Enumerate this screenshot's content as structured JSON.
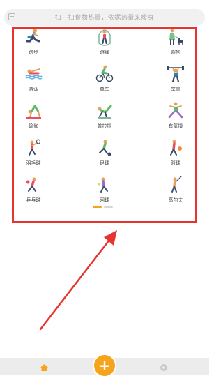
{
  "search": {
    "placeholder": "扫一扫食物热量，依据热量来瘦身"
  },
  "sports": [
    {
      "label": "跑步",
      "icon": "running-icon"
    },
    {
      "label": "跳绳",
      "icon": "jump-rope-icon"
    },
    {
      "label": "遛狗",
      "icon": "dog-walking-icon"
    },
    {
      "label": "游泳",
      "icon": "swimming-icon"
    },
    {
      "label": "单车",
      "icon": "cycling-icon"
    },
    {
      "label": "举重",
      "icon": "weightlifting-icon"
    },
    {
      "label": "瑜伽",
      "icon": "yoga-icon"
    },
    {
      "label": "普拉提",
      "icon": "pilates-icon"
    },
    {
      "label": "有氧操",
      "icon": "aerobics-icon"
    },
    {
      "label": "羽毛球",
      "icon": "badminton-icon"
    },
    {
      "label": "足球",
      "icon": "soccer-icon"
    },
    {
      "label": "篮球",
      "icon": "basketball-icon"
    },
    {
      "label": "乒乓球",
      "icon": "table-tennis-icon"
    },
    {
      "label": "网球",
      "icon": "tennis-icon"
    },
    {
      "label": "高尔夫",
      "icon": "golf-icon"
    }
  ],
  "pager": {
    "total": 2,
    "active": 0,
    "active_color": "#f5a41c",
    "inactive_color": "#d6d6d6"
  },
  "tabbar": {
    "center_label": "+",
    "accent": "#f5a41c"
  },
  "annotation": {
    "color": "#e73431"
  }
}
